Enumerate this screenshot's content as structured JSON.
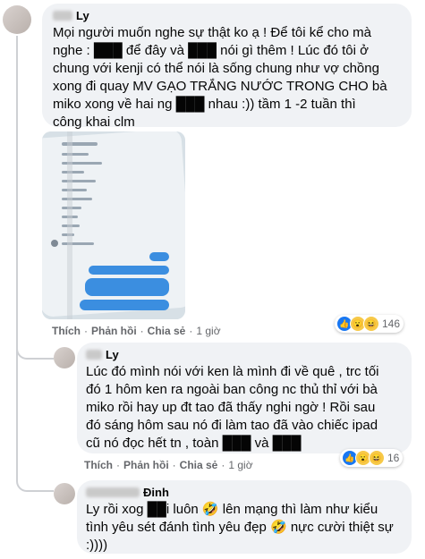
{
  "comments": [
    {
      "author": "Ly",
      "lines": [
        "Mọi người muốn nghe sự thật ko ạ ! Để tôi kể cho mà",
        "nghe : ███ để đây và ███ nói gì thêm ! Lúc đó tôi ở",
        "chung với kenji có thể nói là sống chung như vợ chồng",
        "xong đi quay MV GẠO TRẮNG NƯỚC TRONG CHO bà",
        "miko xong về hai ng ███ nhau :)) tầm 1 -2 tuần thì",
        "công khai clm"
      ],
      "actions": {
        "like": "Thích",
        "reply": "Phản hồi",
        "share": "Chia sẻ",
        "time": "1 giờ"
      },
      "reaction_count": "146"
    },
    {
      "author": "Ly",
      "lines": [
        "Lúc đó mình nói với ken là mình đi về quê , trc tối",
        "đó 1 hôm ken ra ngoài ban công nc thủ thỉ với bà",
        "miko rồi hay up đt tao đã thấy nghi ngờ ! Rồi sau",
        "đó sáng hôm sau nó đi làm tao đã vào chiếc ipad",
        "cũ nó đọc hết tn , toàn ███ và ███"
      ],
      "actions": {
        "like": "Thích",
        "reply": "Phản hồi",
        "share": "Chia sẻ",
        "time": "1 giờ"
      },
      "reaction_count": "16"
    },
    {
      "author": "Đinh",
      "lines": [
        "Ly rồi xog ██i luôn 🤣 lên mạng thì làm như kiểu",
        "tình yêu sét đánh tình yêu đẹp 🤣 nực cười thiệt sự",
        ":))))"
      ]
    }
  ]
}
